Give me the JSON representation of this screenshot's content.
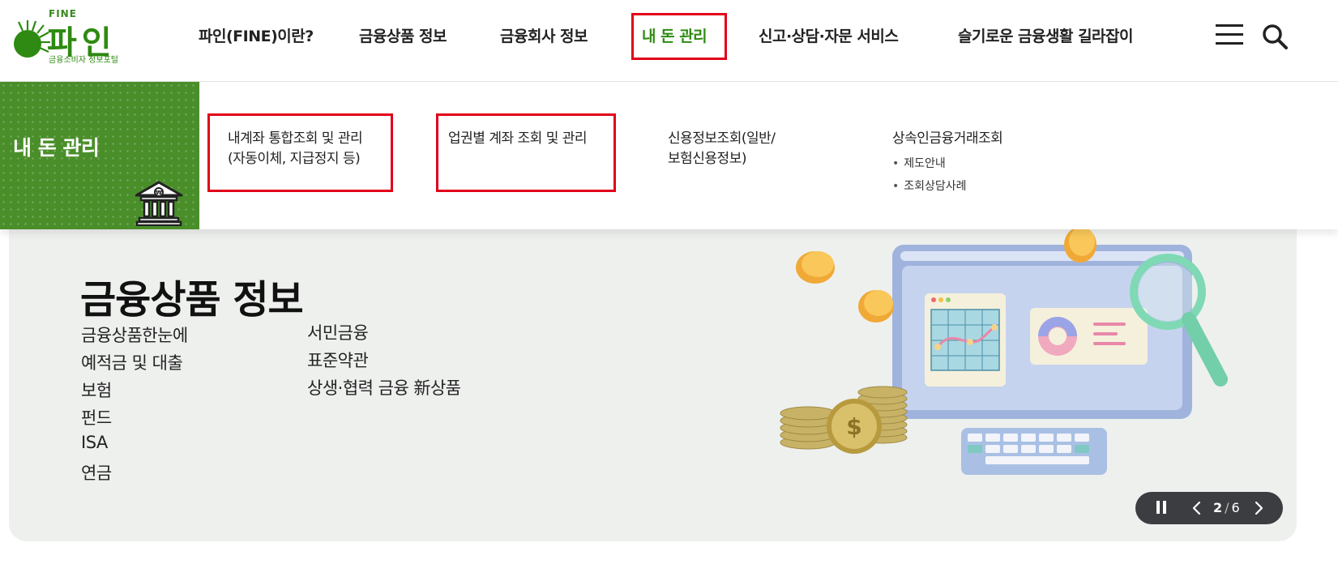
{
  "logo": {
    "fine": "FINE",
    "name": "파인",
    "subtitle": "금융소비자 정보포털"
  },
  "nav": {
    "items": [
      {
        "label": "파인(FINE)이란?"
      },
      {
        "label": "금융상품 정보"
      },
      {
        "label": "금융회사 정보"
      },
      {
        "label": "내 돈 관리",
        "active": true
      },
      {
        "label": "신고·상담·자문 서비스"
      },
      {
        "label": "슬기로운 금융생활 길라잡이"
      }
    ],
    "menu_icon": "hamburger-menu-icon",
    "search_icon": "search-icon"
  },
  "dropdown": {
    "title": "내 돈 관리",
    "icon": "bank-icon",
    "columns": [
      {
        "line1": "내계좌 통합조회 및 관리",
        "line2": "(자동이체, 지급정지 등)"
      },
      {
        "line1": "업권별 계좌 조회 및 관리",
        "line2": ""
      },
      {
        "line1": "신용정보조회(일반/",
        "line2": "보험신용정보)"
      },
      {
        "line1": "상속인금융거래조회",
        "line2": "",
        "subitems": [
          "제도안내",
          "조회상담사례"
        ]
      }
    ]
  },
  "hero": {
    "title": "금융상품 정보",
    "links_left": [
      "금융상품한눈에",
      "예적금 및 대출",
      "보험",
      "펀드",
      "ISA",
      "연금"
    ],
    "links_right": [
      "서민금융",
      "표준약관",
      "상생·협력 금융 新상품"
    ],
    "illustration": "monitor-coins-magnifier-illustration"
  },
  "slider": {
    "current": "2",
    "total": "6",
    "pause_icon": "pause-icon",
    "prev_icon": "chevron-left-icon",
    "next_icon": "chevron-right-icon"
  },
  "colors": {
    "brand_green": "#2e8a12",
    "panel_green": "#4a8e2a",
    "highlight_red": "#e2001a",
    "hero_bg": "#eef0ee"
  }
}
